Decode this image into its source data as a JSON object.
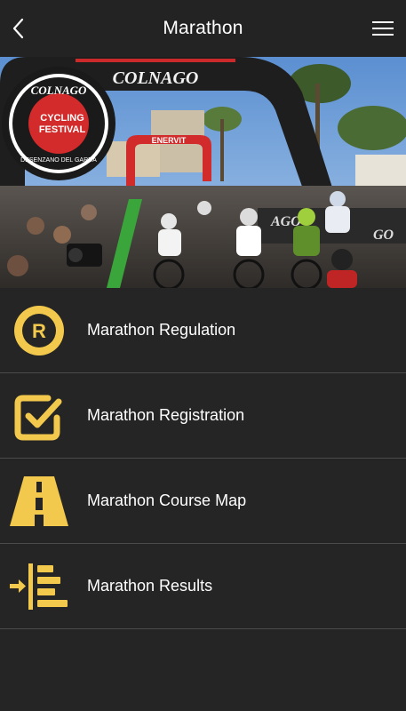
{
  "header": {
    "title": "Marathon"
  },
  "hero": {
    "badge_top": "COLNAGO",
    "badge_middle_1": "CYCLING",
    "badge_middle_2": "FESTIVAL",
    "badge_bottom": "DESENZANO DEL GARDA",
    "arch_text": "COLNAGO",
    "small_arch_text": "ENERVIT",
    "banner_text": "AGO",
    "banner_text_right": "GO"
  },
  "menu": {
    "items": [
      {
        "label": "Marathon Regulation",
        "icon": "regulation-r-icon"
      },
      {
        "label": "Marathon Registration",
        "icon": "checkbox-check-icon"
      },
      {
        "label": "Marathon Course Map",
        "icon": "road-icon"
      },
      {
        "label": "Marathon Results",
        "icon": "results-list-icon"
      }
    ]
  },
  "colors": {
    "background": "#252525",
    "header": "#232323",
    "accent": "#f2c94c",
    "divider": "#4a4a4a"
  }
}
